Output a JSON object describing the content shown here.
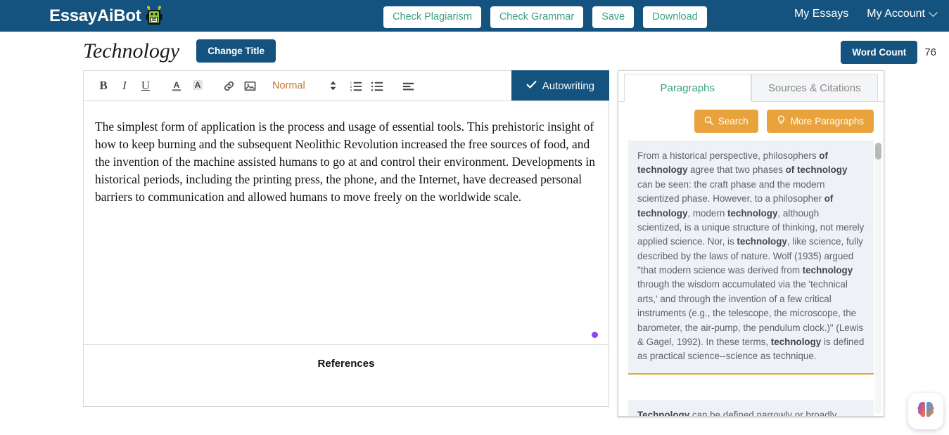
{
  "navbar": {
    "brand": "EssayAiBot",
    "brand_icon": "robot-icon",
    "buttons": [
      {
        "label": "Check Plagiarism",
        "name": "check-plagiarism-button"
      },
      {
        "label": "Check Grammar",
        "name": "check-grammar-button"
      },
      {
        "label": "Save",
        "name": "save-button"
      },
      {
        "label": "Download",
        "name": "download-button"
      }
    ],
    "links": [
      {
        "label": "My Essays",
        "name": "my-essays-link"
      },
      {
        "label": "My Account",
        "name": "my-account-menu"
      }
    ]
  },
  "title_row": {
    "doc_title": "Technology",
    "change_title_label": "Change Title",
    "word_count_label": "Word Count",
    "word_count_value": "76"
  },
  "toolbar": {
    "bold": "B",
    "italic": "I",
    "underline": "U",
    "text_color": "A",
    "highlight": "A",
    "format_label": "Normal",
    "autowriting_label": "Autowriting"
  },
  "editor": {
    "body_text": "The simplest form of application is the process and usage of essential tools. This prehistoric insight of how to keep burning and the subsequent Neolithic Revolution increased the free sources of food, and the invention of the machine assisted humans to go at and control their environment. Developments in historical periods, including the printing press, the phone, and the Internet, have decreased personal barriers to communication and allowed humans to move freely on the worldwide scale.",
    "references_heading": "References"
  },
  "panel": {
    "tabs": [
      {
        "label": "Paragraphs",
        "name": "tab-paragraphs",
        "active": true
      },
      {
        "label": "Sources & Citations",
        "name": "tab-sources-citations",
        "active": false
      }
    ],
    "search_label": "Search",
    "more_paragraphs_label": "More Paragraphs",
    "paragraphs": [
      {
        "text_html": "From a historical perspective, philosophers <b>of technology</b> agree that two phases <b>of technology</b> can be seen: the craft phase and the modern scientized phase. However, to a philosopher <b>of technology</b>, modern <b>technology</b>, although scientized, is a unique structure of thinking, not merely applied science. Nor, is <b>technology</b>, like science, fully described by the laws of nature. Wolf (1935) argued \"that modern science was derived from <b>technology</b> through the wisdom accumulated via the 'technical arts,' and through the invention of a few critical instruments (e.g., the telescope, the microscope, the barometer, the air-pump, the pendulum clock.)\" (Lewis &amp; Gagel, 1992). In these terms, <b>technology</b> is defined as practical science--science as technique."
      },
      {
        "text_html": "<b>Technology</b> can be defined narrowly or broadly"
      }
    ]
  },
  "fab": {
    "icon": "brain-icon"
  },
  "colors": {
    "navy": "#14537f",
    "teal": "#3aa381",
    "orange": "#e8a33d",
    "purple_dot": "#8b4ae8",
    "card_bg": "#eef1f5"
  }
}
